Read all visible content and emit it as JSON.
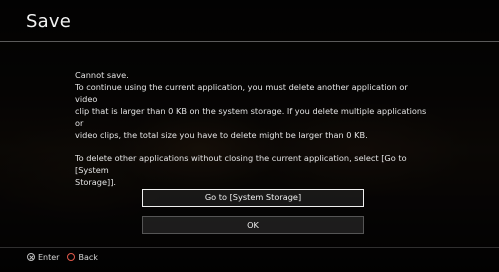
{
  "header": {
    "title": "Save"
  },
  "dialog": {
    "lines": [
      "Cannot save.",
      "To continue using the current application, you must delete another application or video",
      "clip that is larger than 0 KB on the system storage. If you delete multiple applications or",
      "video clips, the total size you have to delete might be larger than 0 KB."
    ],
    "lines2": [
      "To delete other applications without closing the current application, select [Go to [System",
      "Storage]]."
    ]
  },
  "buttons": {
    "primary_label": "Go to [System Storage]",
    "secondary_label": "OK"
  },
  "footer": {
    "enter": {
      "icon": "cross-button-icon",
      "label": "Enter"
    },
    "back": {
      "icon": "circle-button-icon",
      "label": "Back",
      "color": "#e0584a"
    }
  },
  "colors": {
    "background": "#0b0908",
    "text": "#e6e6e6",
    "focus_border": "#f0f0f0"
  }
}
